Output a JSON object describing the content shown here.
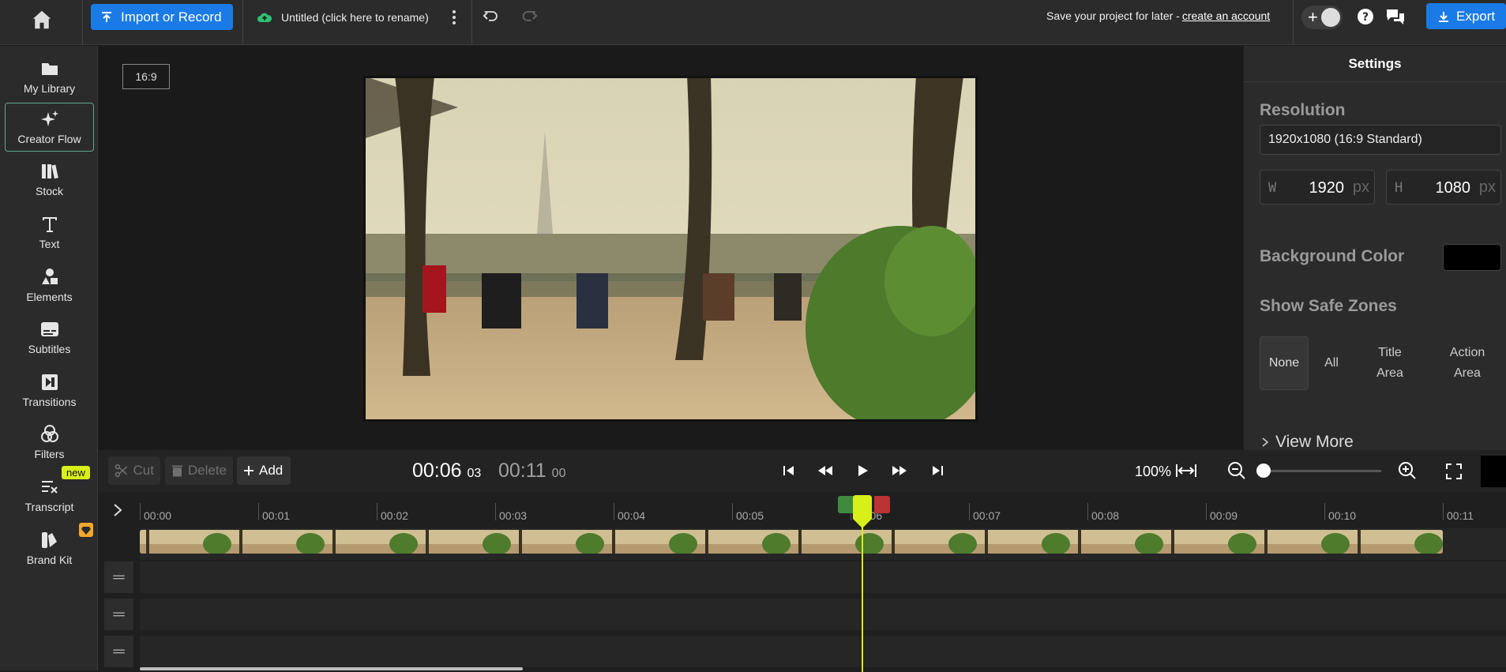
{
  "topbar": {
    "import_label": "Import or Record",
    "project_name": "Untitled (click here to rename)",
    "save_prompt": "Save your project for later -",
    "create_account": "create an account",
    "export_label": "Export",
    "avatar_plus": "+"
  },
  "sidebar": {
    "items": [
      {
        "label": "My Library",
        "icon": "folder-icon"
      },
      {
        "label": "Creator Flow",
        "icon": "sparkle-icon"
      },
      {
        "label": "Stock",
        "icon": "books-icon"
      },
      {
        "label": "Text",
        "icon": "text-icon"
      },
      {
        "label": "Elements",
        "icon": "shapes-icon"
      },
      {
        "label": "Subtitles",
        "icon": "subtitles-icon"
      },
      {
        "label": "Transitions",
        "icon": "transitions-icon"
      },
      {
        "label": "Filters",
        "icon": "filters-icon"
      },
      {
        "label": "Transcript",
        "icon": "transcript-icon"
      },
      {
        "label": "Brand Kit",
        "icon": "brand-kit-icon"
      }
    ],
    "new_badge": "new"
  },
  "canvas": {
    "ratio_label": "16:9"
  },
  "settings": {
    "title": "Settings",
    "resolution_label": "Resolution",
    "resolution_value": "1920x1080 (16:9 Standard)",
    "width_letter": "W",
    "width_value": "1920",
    "height_letter": "H",
    "height_value": "1080",
    "unit": "px",
    "bg_color_label": "Background Color",
    "bg_color_value": "#000000",
    "safe_zones_label": "Show Safe Zones",
    "safe_zones": {
      "none": "None",
      "all": "All",
      "title_area": "Title\nArea",
      "action_area": "Action\nArea",
      "selected": "None"
    },
    "view_more": "View More"
  },
  "timeline_toolbar": {
    "cut": "Cut",
    "delete": "Delete",
    "add": "Add",
    "current_time_main": "00:06",
    "current_time_frames": "03",
    "total_time_main": "00:11",
    "total_time_frames": "00",
    "zoom": "100%"
  },
  "timeline": {
    "ruler_labels": [
      "00:00",
      "00:01",
      "00:02",
      "00:03",
      "00:04",
      "00:05",
      "00:06",
      "00:07",
      "00:08",
      "00:09",
      "00:10",
      "00:11"
    ],
    "playhead_seconds": 6.1,
    "clip_end_seconds": 11.0,
    "accent": "#d8ef1a"
  },
  "colors": {
    "primary_button": "#1b7be6",
    "accent": "#d8ef1a",
    "badge_gem": "#f2a62b"
  }
}
